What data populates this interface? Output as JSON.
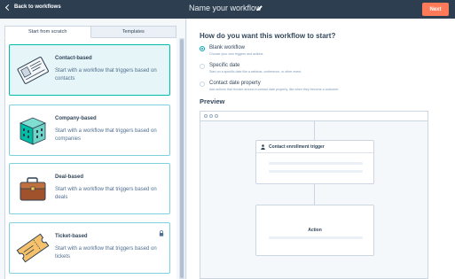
{
  "header": {
    "back_label": "Back to workflows",
    "workflow_name": "Name your workflow",
    "next_label": "Next"
  },
  "colors": {
    "topbar": "#2d3e50",
    "accent_orange": "#ff7a59",
    "selected_border": "#00bda5",
    "radio_teal": "#00a4bd"
  },
  "tabs": [
    {
      "label": "Start from scratch",
      "active": true
    },
    {
      "label": "Templates",
      "active": false
    }
  ],
  "cards": [
    {
      "title": "Contact-based",
      "description": "Start with a workflow that triggers based on contacts",
      "icon": "contact-card-icon",
      "selected": true
    },
    {
      "title": "Company-based",
      "description": "Start with a workflow that triggers based on companies",
      "icon": "building-icon",
      "selected": false
    },
    {
      "title": "Deal-based",
      "description": "Start with a workflow that triggers based on deals",
      "icon": "briefcase-icon",
      "selected": false
    },
    {
      "title": "Ticket-based",
      "description": "Start with a workflow that triggers based on tickets",
      "icon": "ticket-icon",
      "selected": false,
      "locked": true
    }
  ],
  "start_options": {
    "question": "How do you want this workflow to start?",
    "options": [
      {
        "label": "Blank workflow",
        "description": "Choose your own triggers and actions.",
        "checked": true
      },
      {
        "label": "Specific date",
        "description": "Start on a specific date like a webinar, conference, or other event.",
        "checked": false
      },
      {
        "label": "Contact date property",
        "description": "Add actions that revolve around a contact date property, like when they become a customer.",
        "checked": false
      }
    ]
  },
  "preview": {
    "label": "Preview",
    "trigger_title": "Contact enrollment trigger",
    "action_label": "Action"
  }
}
